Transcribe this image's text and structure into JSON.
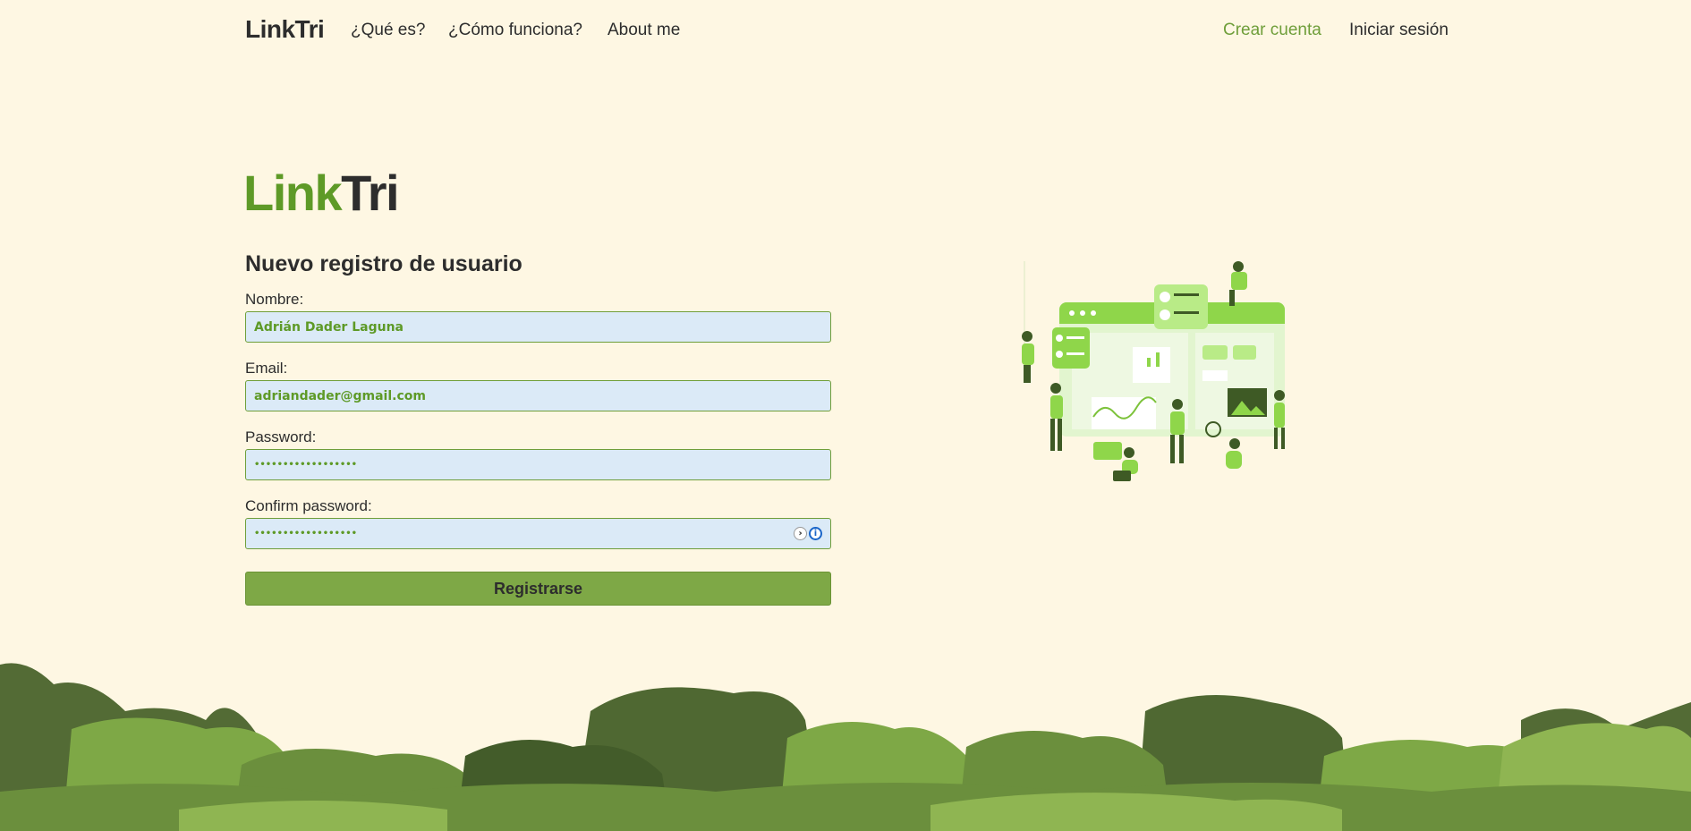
{
  "nav": {
    "brand": "LinkTri",
    "links": [
      {
        "label": "¿Qué es?"
      },
      {
        "label": "¿Cómo funciona?"
      },
      {
        "label": "About me"
      }
    ],
    "right": [
      {
        "label": "Crear cuenta",
        "active": true
      },
      {
        "label": "Iniciar sesión",
        "active": false
      }
    ]
  },
  "hero": {
    "logo_green": "Link",
    "logo_dark": "Tri"
  },
  "form": {
    "title": "Nuevo registro de usuario",
    "fields": [
      {
        "label": "Nombre:",
        "value": "Adrián Dader Laguna",
        "type": "text"
      },
      {
        "label": "Email:",
        "value": "adriandader@gmail.com",
        "type": "email"
      },
      {
        "label": "Password:",
        "value": "••••••••••••••••••",
        "type": "password"
      },
      {
        "label": "Confirm password:",
        "value": "••••••••••••••••••",
        "type": "password"
      }
    ],
    "submit_label": "Registrarse"
  },
  "colors": {
    "background": "#fef7e3",
    "accent": "#6f9e3a",
    "brand_green": "#5e9a27",
    "button": "#7ea846",
    "input_bg": "#dbeaf7"
  }
}
